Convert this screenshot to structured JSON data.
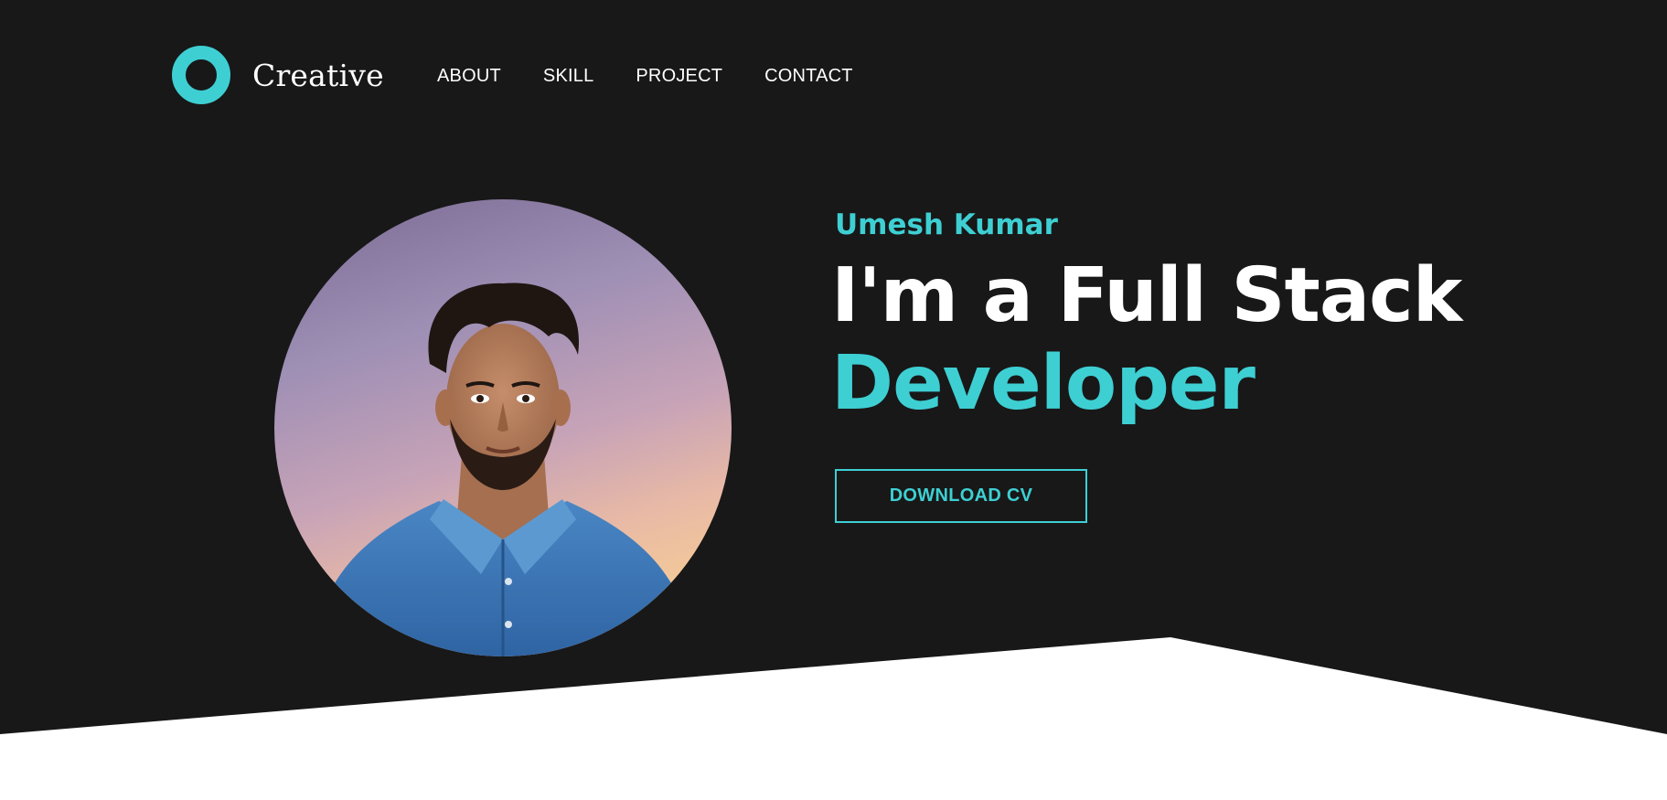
{
  "brand": {
    "name": "Creative",
    "logo_icon": "ring-logo-icon"
  },
  "nav": {
    "items": [
      {
        "label": "ABOUT"
      },
      {
        "label": "SKILL"
      },
      {
        "label": "PROJECT"
      },
      {
        "label": "CONTACT"
      }
    ]
  },
  "hero": {
    "name": "Umesh Kumar",
    "headline_line1": "I'm a Full Stack",
    "headline_line2": "Developer",
    "cta_label": "DOWNLOAD CV",
    "photo": "profile-photo"
  },
  "colors": {
    "accent": "#3ecfd3",
    "background": "#181818",
    "text": "#ffffff",
    "section_bottom": "#ffffff"
  }
}
